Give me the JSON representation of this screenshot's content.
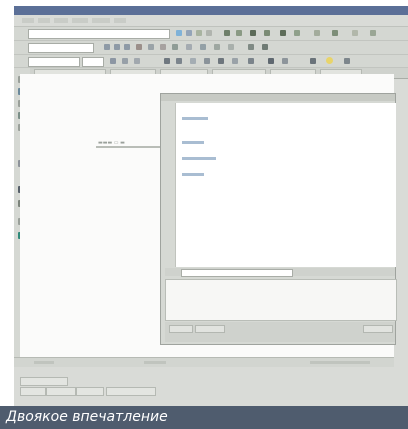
{
  "caption": "Двоякое впечатление",
  "colors": {
    "caption_bg": "#4f5c6e",
    "titlebar": "#5b6f97",
    "window_bg": "#d9dbd7",
    "code_text": "#7f9ab8"
  },
  "icons": [
    "app-icon",
    "toolbar-icons",
    "palette-icons"
  ]
}
